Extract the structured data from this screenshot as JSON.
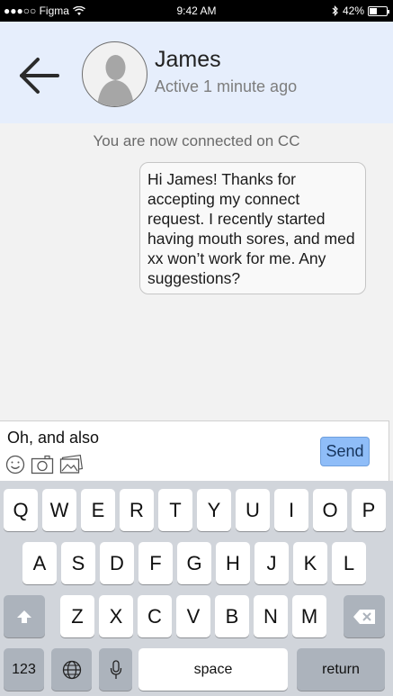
{
  "status_bar": {
    "carrier": "●●●○○ Figma",
    "time": "9:42 AM",
    "battery": "42%",
    "battery_level": 0.42
  },
  "header": {
    "name": "James",
    "status": "Active 1 minute ago"
  },
  "chat": {
    "system_message": "You are now connected on CC",
    "messages": [
      {
        "text": "Hi James! Thanks for accepting my connect request. I recently started having mouth sores, and med xx won’t work for me. Any suggestions?"
      }
    ]
  },
  "composer": {
    "value": "Oh, and also",
    "send_label": "Send",
    "icons": [
      "emoji-icon",
      "camera-icon",
      "gallery-icon"
    ]
  },
  "keyboard": {
    "row1": [
      "Q",
      "W",
      "E",
      "R",
      "T",
      "Y",
      "U",
      "I",
      "O",
      "P"
    ],
    "row2": [
      "A",
      "S",
      "D",
      "F",
      "G",
      "H",
      "J",
      "K",
      "L"
    ],
    "row3": [
      "Z",
      "X",
      "C",
      "V",
      "B",
      "N",
      "M"
    ],
    "numbers_label": "123",
    "space_label": "space",
    "return_label": "return"
  },
  "colors": {
    "header_bg": "#e6eefc",
    "send_bg": "#8fbdf8",
    "keyboard_bg": "#d1d5db"
  }
}
